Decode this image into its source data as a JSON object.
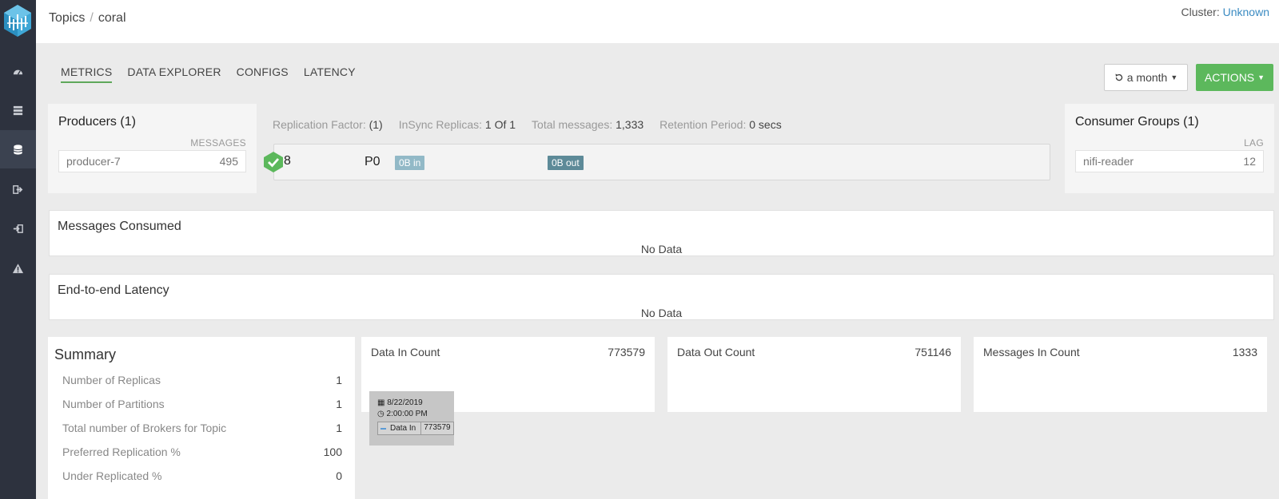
{
  "breadcrumb": {
    "root": "Topics",
    "separator": "/",
    "current": "coral"
  },
  "cluster": {
    "label": "Cluster:",
    "value": "Unknown"
  },
  "tabs": [
    {
      "label": "METRICS",
      "active": true
    },
    {
      "label": "DATA EXPLORER",
      "active": false
    },
    {
      "label": "CONFIGS",
      "active": false
    },
    {
      "label": "LATENCY",
      "active": false
    }
  ],
  "time_range": {
    "label": "a month"
  },
  "actions": {
    "label": "ACTIONS"
  },
  "producers": {
    "title": "Producers (1)",
    "column": "MESSAGES",
    "items": [
      {
        "name": "producer-7",
        "value": "495"
      }
    ]
  },
  "consumers": {
    "title": "Consumer Groups (1)",
    "column": "LAG",
    "items": [
      {
        "name": "nifi-reader",
        "value": "12"
      }
    ]
  },
  "stats": {
    "replication_factor": {
      "label": "Replication Factor:",
      "value": "(1)"
    },
    "insync": {
      "label": "InSync Replicas:",
      "value": "1 Of 1"
    },
    "total_messages": {
      "label": "Total messages:",
      "value": "1,333"
    },
    "retention": {
      "label": "Retention Period:",
      "value": "0 secs"
    }
  },
  "partition": {
    "broker": "8",
    "id": "P0",
    "in": "0B in",
    "out": "0B out",
    "status_color": "#5cb85c"
  },
  "messages_consumed": {
    "title": "Messages Consumed",
    "empty": "No Data"
  },
  "latency": {
    "title": "End-to-end Latency",
    "empty": "No Data"
  },
  "summary": {
    "title": "Summary",
    "rows": [
      {
        "label": "Number of Replicas",
        "value": "1"
      },
      {
        "label": "Number of Partitions",
        "value": "1"
      },
      {
        "label": "Total number of Brokers for Topic",
        "value": "1"
      },
      {
        "label": "Preferred Replication %",
        "value": "100"
      },
      {
        "label": "Under Replicated %",
        "value": "0"
      }
    ]
  },
  "metrics": [
    {
      "label": "Data In Count",
      "value": "773579"
    },
    {
      "label": "Data Out Count",
      "value": "751146"
    },
    {
      "label": "Messages In Count",
      "value": "1333"
    }
  ],
  "tooltip": {
    "date": "8/22/2019",
    "time": "2:00:00 PM",
    "series": "Data In",
    "value": "773579"
  },
  "colors": {
    "sidebar": "#2d323e",
    "accent_green": "#5cb85c",
    "link": "#3b8bc2"
  }
}
